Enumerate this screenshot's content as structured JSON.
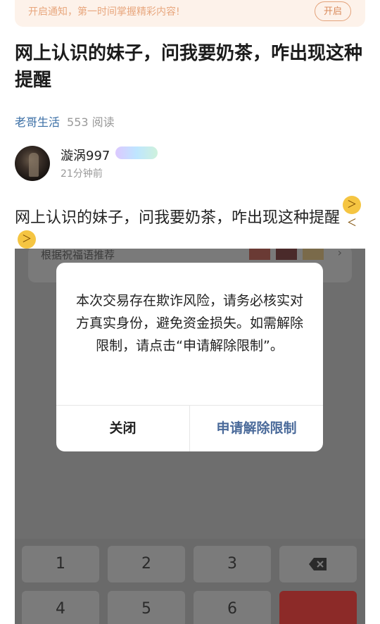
{
  "notify": {
    "text": "开启通知，第一时间掌握精彩内容!",
    "button": "开启"
  },
  "article": {
    "title": "网上认识的妹子，问我要奶茶，咋出现这种提醒",
    "source": "老哥生活",
    "reads": "553 阅读"
  },
  "author": {
    "name": "漩涡997",
    "time": "21分钟前"
  },
  "post": {
    "text": "网上认识的妹子，问我要奶茶，咋出现这种提醒",
    "emoji": [
      "grinning-squint-emoji",
      "grinning-squint-emoji"
    ]
  },
  "screenshot": {
    "card_text": "根据祝福语推荐",
    "dialog": {
      "message": "本次交易存在欺诈风险，请务必核实对方真实身份，避免资金损失。如需解除限制，请点击“申请解除限制”。",
      "close_label": "关闭",
      "apply_label": "申请解除限制"
    },
    "keys": [
      "1",
      "2",
      "3",
      "4",
      "5",
      "6"
    ]
  }
}
